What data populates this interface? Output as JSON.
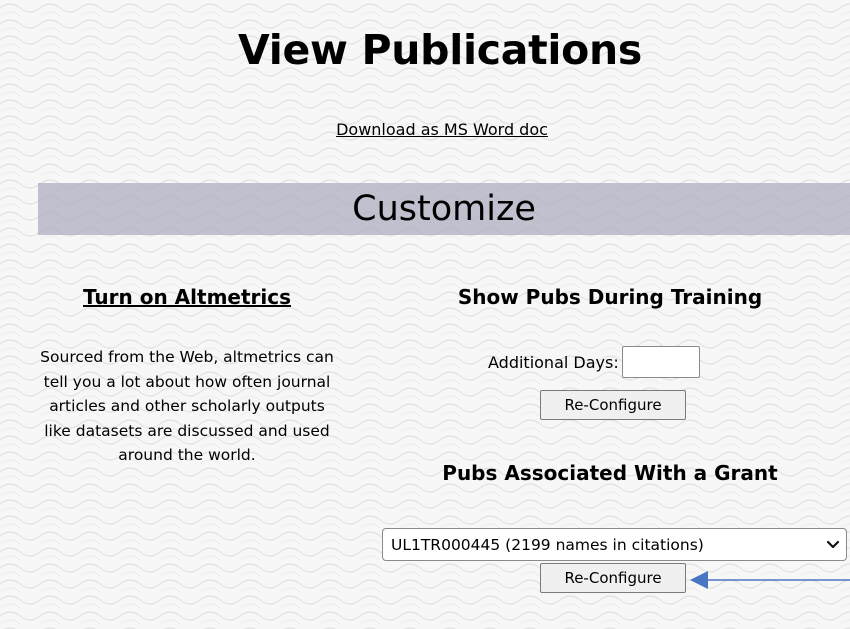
{
  "page": {
    "title": "View Publications",
    "download_link": "Download as MS Word doc"
  },
  "customize": {
    "heading": "Customize",
    "altmetrics": {
      "link": "Turn on Altmetrics",
      "description": "Sourced from the Web, altmetrics can tell you a lot about how often journal articles and other scholarly outputs like datasets are discussed and used around the world."
    },
    "training": {
      "heading": "Show Pubs During Training",
      "days_label": "Additional Days:",
      "days_value": "",
      "button": "Re-Configure"
    },
    "grant": {
      "heading": "Pubs Associated With a Grant",
      "selected": "UL1TR000445 (2199 names in citations)",
      "button": "Re-Configure"
    }
  },
  "colors": {
    "customize_bar": "#b4b4c4",
    "annotation_arrow": "#4a74c4"
  },
  "icons": {
    "select": "chevron-down-icon",
    "annotation": "arrow-left-icon"
  }
}
